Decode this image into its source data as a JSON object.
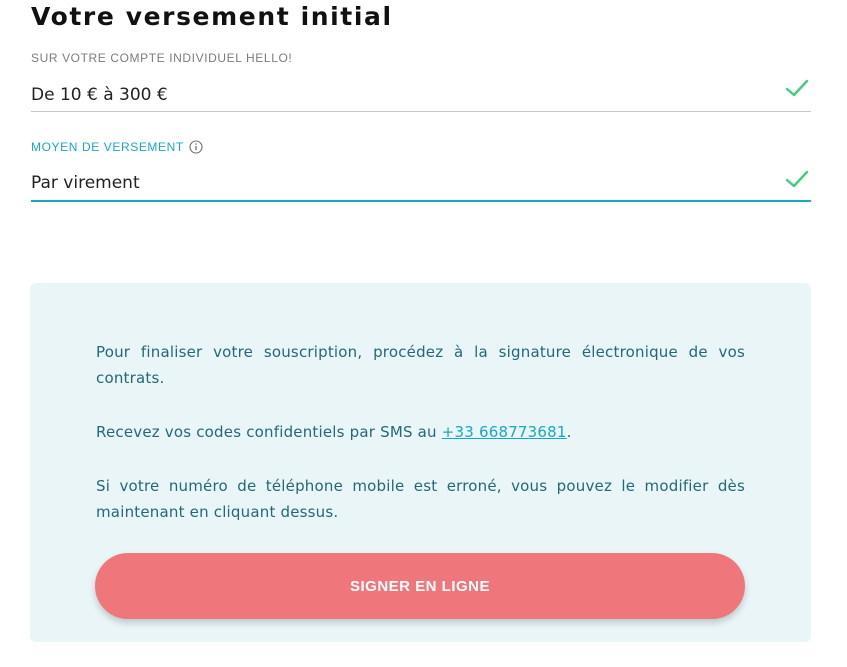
{
  "page": {
    "title": "Votre versement initial"
  },
  "fields": [
    {
      "label": "SUR VOTRE COMPTE INDIVIDUEL HELLO!",
      "value": "De 10 € à 300 €",
      "validated": true
    },
    {
      "label": "MOYEN DE VERSEMENT",
      "value": "Par virement",
      "validated": true,
      "has_info_icon": true,
      "focused": true
    }
  ],
  "panel": {
    "paragraph_1": "Pour finaliser votre souscription, procédez à la signature électronique de vos contrats.",
    "paragraph_2_before": "Recevez vos codes confidentiels par SMS au ",
    "phone_number": "+33 668773681",
    "paragraph_2_after": ".",
    "paragraph_3": "Si votre numéro de téléphone mobile est erroné, vous pouvez le modifier dès maintenant en cliquant dessus.",
    "button_label": "SIGNER EN LIGNE"
  },
  "colors": {
    "accent": "#17a9c2",
    "check": "#3ecf7a",
    "panel_background": "#e9f5f7",
    "panel_text": "#256878",
    "button": "#ef767a"
  },
  "icons": {
    "check": "check-icon",
    "info": "info-icon"
  }
}
